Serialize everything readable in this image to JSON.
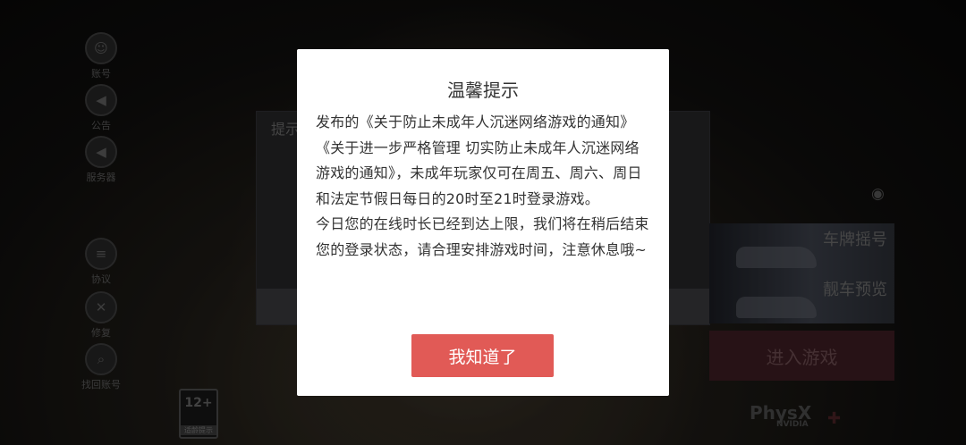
{
  "side_menu": {
    "items": [
      {
        "label": "账号",
        "icon": "account-icon"
      },
      {
        "label": "公告",
        "icon": "megaphone-icon"
      },
      {
        "label": "服务器",
        "icon": "server-icon"
      },
      {
        "label": "协议",
        "icon": "document-icon"
      },
      {
        "label": "修复",
        "icon": "wrench-icon"
      },
      {
        "label": "找回账号",
        "icon": "recover-account-icon"
      }
    ]
  },
  "age_rating": {
    "age": "12+",
    "caption": "适龄提示"
  },
  "background_dialog": {
    "title": "提示"
  },
  "right_panel": {
    "plate_label": "车牌摇号",
    "preview_label": "靓车预览",
    "enter_label": "进入游戏"
  },
  "logos": {
    "physx": "PhysX",
    "nvidia": "NVIDIA"
  },
  "modal": {
    "title": "温馨提示",
    "paragraph1": "发布的《关于防止未成年人沉迷网络游戏的通知》《关于进一步严格管理 切实防止未成年人沉迷网络游戏的通知》，未成年玩家仅可在周五、周六、周日和法定节假日每日的20时至21时登录游戏。",
    "paragraph2": "今日您的在线时长已经到达上限，我们将在稍后结束您的登录状态，请合理安排游戏时间，注意休息哦~",
    "confirm_label": "我知道了"
  },
  "colors": {
    "accent": "#e15a56",
    "modal_bg": "#ffffff",
    "text": "#333333"
  }
}
